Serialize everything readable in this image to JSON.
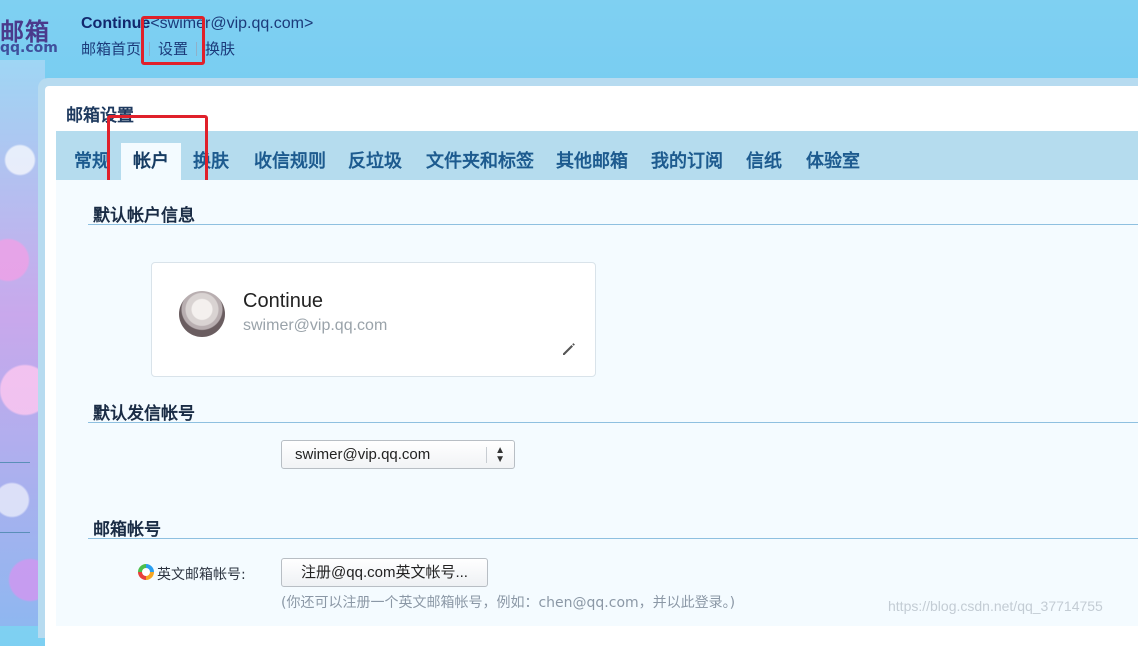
{
  "header": {
    "logo_text": "邮箱",
    "logo_sub": "qq.com",
    "user_name": "Continue",
    "user_email_wrapped": "<swimer@vip.qq.com>",
    "nav": [
      {
        "label": "邮箱首页"
      },
      {
        "label": "设置"
      },
      {
        "label": "换肤"
      }
    ]
  },
  "settings": {
    "title": "邮箱设置",
    "tabs": [
      {
        "label": "常规"
      },
      {
        "label": "帐户"
      },
      {
        "label": "换肤"
      },
      {
        "label": "收信规则"
      },
      {
        "label": "反垃圾"
      },
      {
        "label": "文件夹和标签"
      },
      {
        "label": "其他邮箱"
      },
      {
        "label": "我的订阅"
      },
      {
        "label": "信纸"
      },
      {
        "label": "体验室"
      }
    ],
    "active_tab": "帐户"
  },
  "sections": {
    "default_account": {
      "title": "默认帐户信息",
      "name": "Continue",
      "email": "swimer@vip.qq.com",
      "edit_icon": "pencil-icon"
    },
    "default_sender": {
      "title": "默认发信帐号",
      "selected": "swimer@vip.qq.com"
    },
    "mail_account": {
      "title": "邮箱帐号",
      "label": "英文邮箱帐号:",
      "button": "注册@qq.com英文帐号...",
      "hint": "(你还可以注册一个英文邮箱帐号，例如：chen@qq.com，并以此登录。)"
    }
  },
  "watermark": "https://blog.csdn.net/qq_37714755",
  "colors": {
    "annotation_red": "#e0202a",
    "tabbar": "#b5dcee",
    "tab_text": "#1d5b8f"
  }
}
